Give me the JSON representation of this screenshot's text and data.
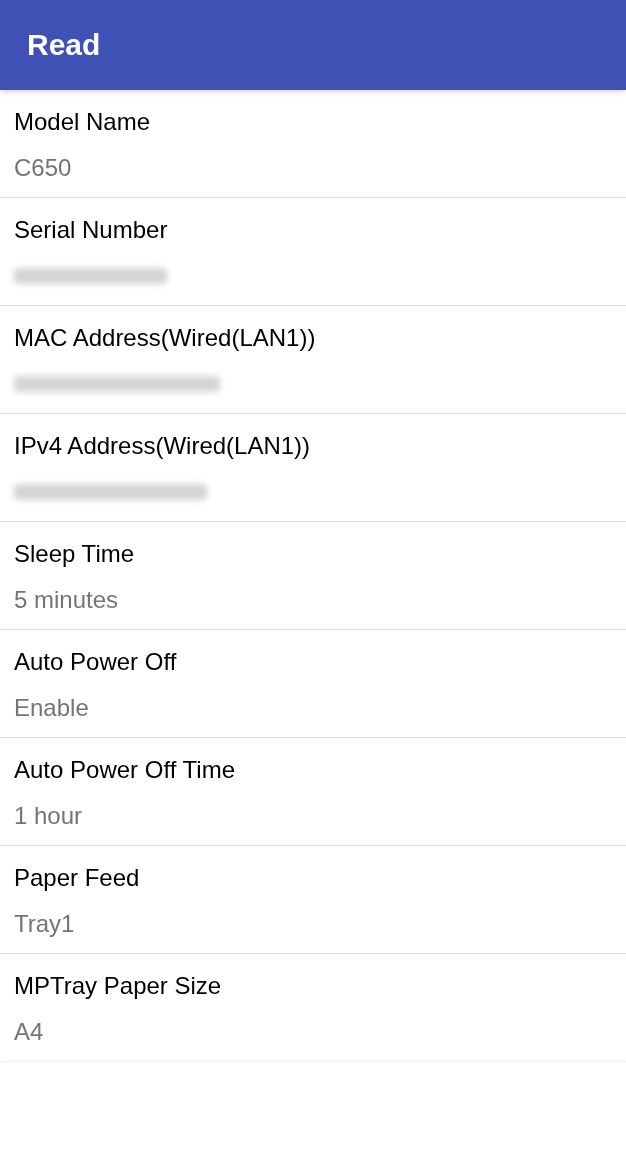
{
  "app_bar": {
    "title": "Read"
  },
  "settings": [
    {
      "kind": "text",
      "label": "Model Name",
      "value": "C650"
    },
    {
      "kind": "blurred",
      "label": "Serial Number"
    },
    {
      "kind": "blurred",
      "label": "MAC Address(Wired(LAN1))"
    },
    {
      "kind": "blurred",
      "label": "IPv4 Address(Wired(LAN1))"
    },
    {
      "kind": "text",
      "label": "Sleep Time",
      "value": "5 minutes"
    },
    {
      "kind": "text",
      "label": "Auto Power Off",
      "value": "Enable"
    },
    {
      "kind": "text",
      "label": "Auto Power Off Time",
      "value": "1 hour"
    },
    {
      "kind": "text",
      "label": "Paper Feed",
      "value": "Tray1"
    },
    {
      "kind": "text",
      "label": "MPTray Paper Size",
      "value": "A4"
    }
  ]
}
